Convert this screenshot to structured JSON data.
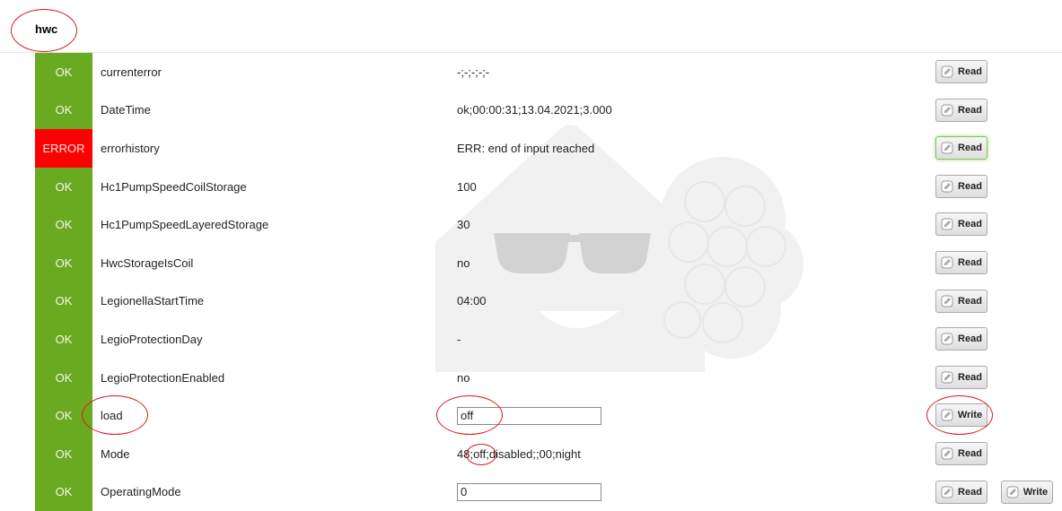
{
  "section": {
    "title": "hwc"
  },
  "rows": [
    {
      "status": "OK",
      "name": "currenterror",
      "value": "-;-;-;-;-",
      "buttons": [
        "Read"
      ]
    },
    {
      "status": "OK",
      "name": "DateTime",
      "value": "ok;00:00:31;13.04.2021;3.000",
      "buttons": [
        "Read"
      ]
    },
    {
      "status": "ERROR",
      "name": "errorhistory",
      "value": "ERR: end of input reached",
      "buttons": [
        "Read"
      ]
    },
    {
      "status": "OK",
      "name": "Hc1PumpSpeedCoilStorage",
      "value": "100",
      "buttons": [
        "Read"
      ]
    },
    {
      "status": "OK",
      "name": "Hc1PumpSpeedLayeredStorage",
      "value": "30",
      "buttons": [
        "Read"
      ]
    },
    {
      "status": "OK",
      "name": "HwcStorageIsCoil",
      "value": "no",
      "buttons": [
        "Read"
      ]
    },
    {
      "status": "OK",
      "name": "LegionellaStartTime",
      "value": "04:00",
      "buttons": [
        "Read"
      ]
    },
    {
      "status": "OK",
      "name": "LegioProtectionDay",
      "value": "-",
      "buttons": [
        "Read"
      ]
    },
    {
      "status": "OK",
      "name": "LegioProtectionEnabled",
      "value": "no",
      "buttons": [
        "Read"
      ]
    },
    {
      "status": "OK",
      "name": "load",
      "input_value": "off",
      "buttons": [
        "Write"
      ]
    },
    {
      "status": "OK",
      "name": "Mode",
      "value": "48;off;disabled;;00;night",
      "buttons": [
        "Read"
      ]
    },
    {
      "status": "OK",
      "name": "OperatingMode",
      "input_value": "0",
      "buttons": [
        "Read",
        "Write"
      ]
    }
  ],
  "icons": {
    "button_icon": "edit-icon",
    "watermark": "house-with-sunglasses-logo"
  },
  "colors": {
    "ok": "#6aaa22",
    "error": "#ff0000",
    "annotation": "#d81b1b",
    "highlight": "#84c25a"
  }
}
